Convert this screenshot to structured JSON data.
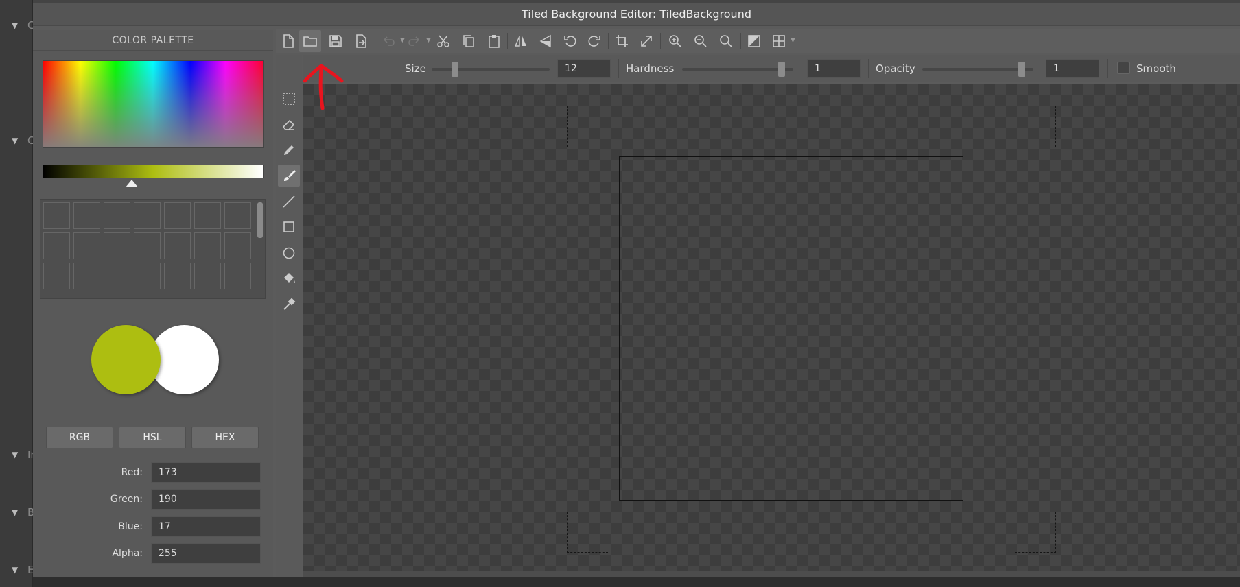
{
  "background_app": {
    "left_sections": [
      "C",
      "C",
      "In",
      "B",
      "E"
    ]
  },
  "dialog": {
    "title": "Tiled Background Editor: TiledBackground"
  },
  "palette": {
    "title": "COLOR PALETTE",
    "foreground_color": "#adbe11",
    "background_color": "#ffffff",
    "modes": [
      "RGB",
      "HSL",
      "HEX"
    ],
    "fields": [
      {
        "label": "Red:",
        "value": "173"
      },
      {
        "label": "Green:",
        "value": "190"
      },
      {
        "label": "Blue:",
        "value": "17"
      },
      {
        "label": "Alpha:",
        "value": "255"
      }
    ]
  },
  "toolbar": {
    "icons": [
      "new-file-icon",
      "open-folder-icon",
      "save-icon",
      "export-icon",
      "undo-icon",
      "redo-icon",
      "cut-icon",
      "copy-icon",
      "paste-icon",
      "flip-horizontal-icon",
      "flip-vertical-icon",
      "rotate-left-icon",
      "rotate-right-icon",
      "crop-icon",
      "resize-icon",
      "zoom-in-icon",
      "zoom-out-icon",
      "zoom-reset-icon",
      "toggle-background-icon",
      "grid-icon"
    ]
  },
  "options": {
    "size_label": "Size",
    "size_value": "12",
    "size_level": 0.18,
    "hardness_label": "Hardness",
    "hardness_value": "1",
    "hardness_level": 0.92,
    "opacity_label": "Opacity",
    "opacity_value": "1",
    "opacity_level": 0.92,
    "smooth_label": "Smooth"
  },
  "tools": [
    "rectangle-select-icon",
    "eraser-icon",
    "pencil-icon",
    "brush-icon",
    "line-icon",
    "rectangle-icon",
    "ellipse-icon",
    "fill-bucket-icon",
    "eyedropper-icon"
  ],
  "annotation": {
    "color": "#e8141e"
  }
}
